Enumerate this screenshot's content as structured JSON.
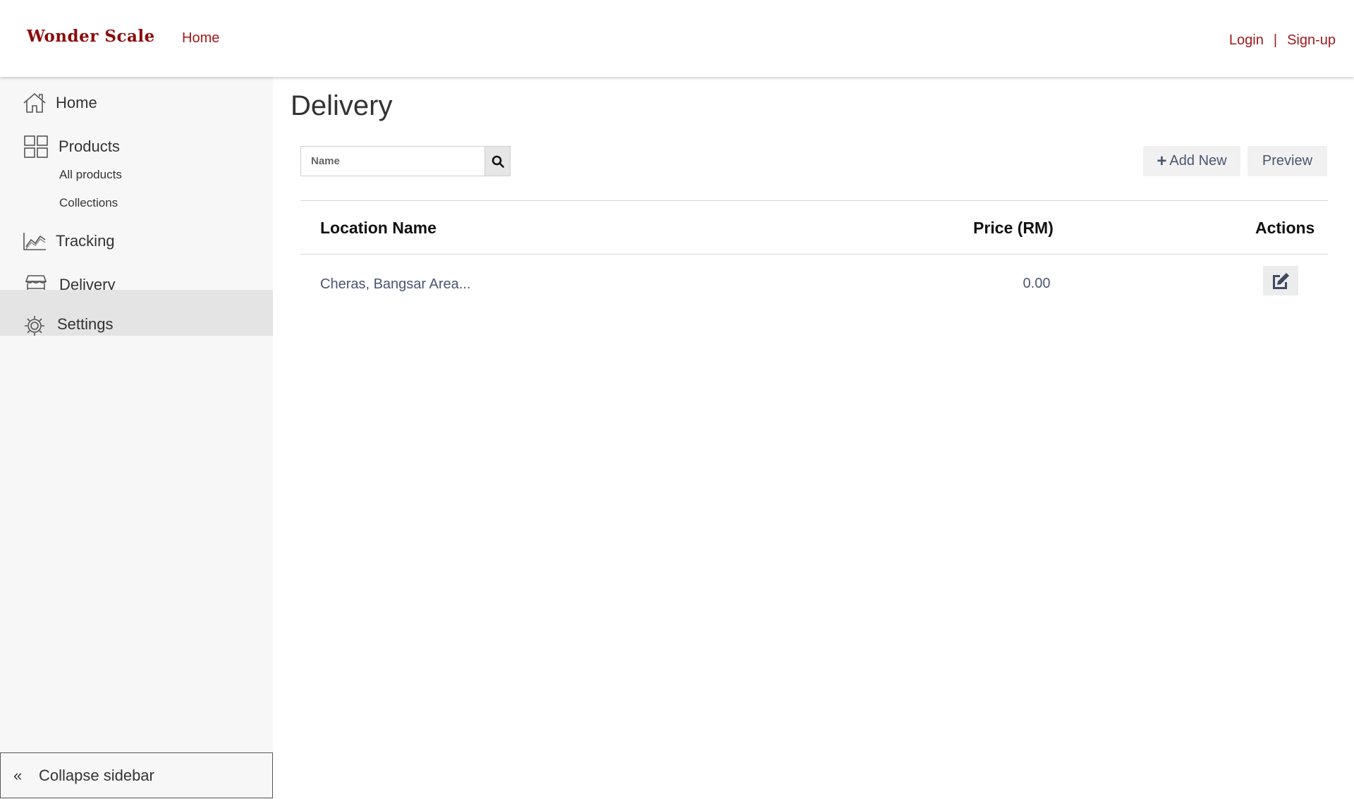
{
  "header": {
    "brand": "Wonder Scale",
    "home_link": "Home",
    "login": "Login",
    "separator": "|",
    "signup": "Sign-up",
    "brand_color": "#8b0a0a",
    "link_color": "#a3191b"
  },
  "sidebar": {
    "items": [
      {
        "label": "Home",
        "icon": "home-icon"
      },
      {
        "label": "Products",
        "icon": "grid-icon",
        "sub_items": [
          "All products",
          "Collections"
        ]
      },
      {
        "label": "Tracking",
        "icon": "chart-icon"
      },
      {
        "label": "Delivery",
        "icon": "store-icon"
      },
      {
        "label": "Settings",
        "icon": "gear-icon",
        "active": true
      }
    ],
    "collapse_label": "Collapse sidebar",
    "collapse_icon": "«"
  },
  "main": {
    "title": "Delivery",
    "search": {
      "placeholder": "Name",
      "icon": "search-icon"
    },
    "add_new_label": "Add New",
    "add_new_icon": "+",
    "preview_label": "Preview",
    "table": {
      "columns": [
        "Location Name",
        "Price (RM)",
        "Actions"
      ],
      "rows": [
        {
          "location": "Cheras, Bangsar Area...",
          "price": "0.00",
          "action_icon": "edit-icon"
        }
      ]
    }
  }
}
